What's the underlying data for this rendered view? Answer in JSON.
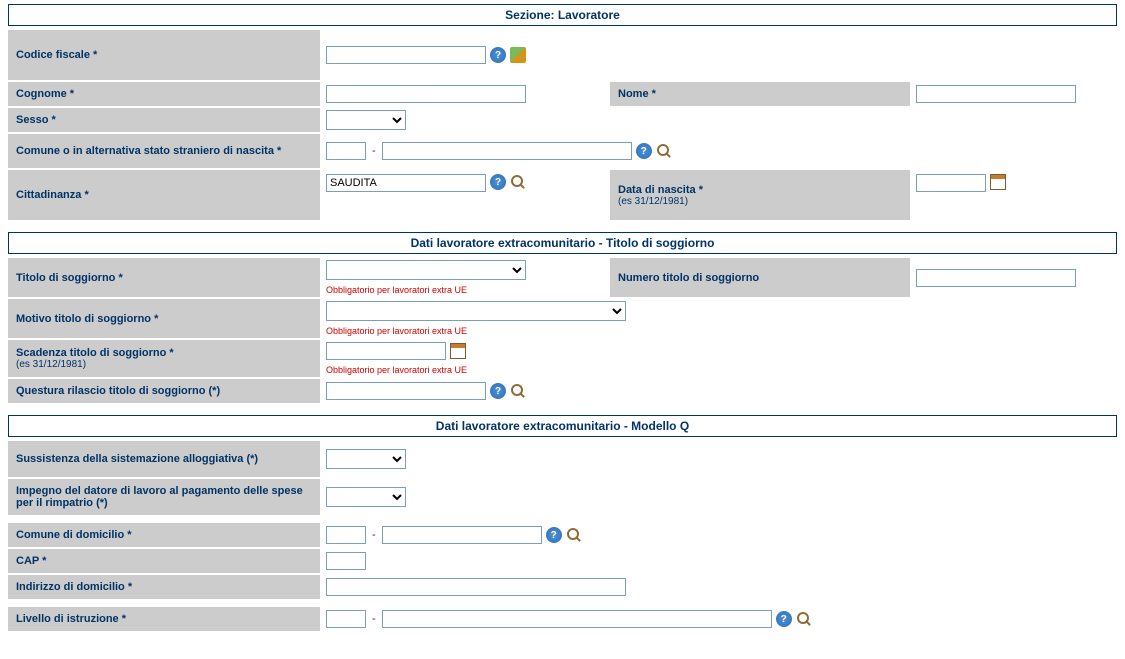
{
  "sections": {
    "s1": "Sezione: Lavoratore",
    "s2": "Dati lavoratore extracomunitario - Titolo di soggiorno",
    "s3": "Dati lavoratore extracomunitario - Modello Q"
  },
  "labels": {
    "codice_fiscale": "Codice fiscale *",
    "cognome": "Cognome *",
    "nome": "Nome *",
    "sesso": "Sesso *",
    "comune_nascita": "Comune o in alternativa stato straniero di nascita *",
    "cittadinanza": "Cittadinanza *",
    "data_nascita": "Data di nascita *",
    "data_nascita_ex": "(es 31/12/1981)",
    "titolo_soggiorno": "Titolo di soggiorno *",
    "numero_titolo": "Numero titolo di soggiorno",
    "motivo_titolo": "Motivo titolo di soggiorno *",
    "scadenza_titolo": "Scadenza titolo di soggiorno *",
    "scadenza_ex": "(es 31/12/1981)",
    "questura": "Questura rilascio titolo di soggiorno (*)",
    "sussistenza": "Sussistenza della sistemazione alloggiativa (*)",
    "impegno": "Impegno del datore di lavoro al pagamento delle spese per il rimpatrio (*)",
    "comune_dom": "Comune di domicilio *",
    "cap": "CAP *",
    "indirizzo_dom": "Indirizzo di domicilio *",
    "livello_istruzione": "Livello di istruzione *"
  },
  "values": {
    "codice_fiscale": "",
    "cognome": "",
    "nome": "",
    "sesso": "",
    "comune_nascita_code": "",
    "comune_nascita_desc": "",
    "cittadinanza": "SAUDITA",
    "data_nascita": "",
    "titolo_soggiorno": "",
    "numero_titolo": "",
    "motivo_titolo": "",
    "scadenza_titolo": "",
    "questura": "",
    "sussistenza": "",
    "impegno": "",
    "comune_dom_code": "",
    "comune_dom_desc": "",
    "cap": "",
    "indirizzo_dom": "",
    "livello_code": "",
    "livello_desc": ""
  },
  "hints": {
    "extra_ue": "Obbligatorio per lavoratori extra UE"
  },
  "icons": {
    "help": "?",
    "search": "",
    "edit": "",
    "calendar": ""
  }
}
